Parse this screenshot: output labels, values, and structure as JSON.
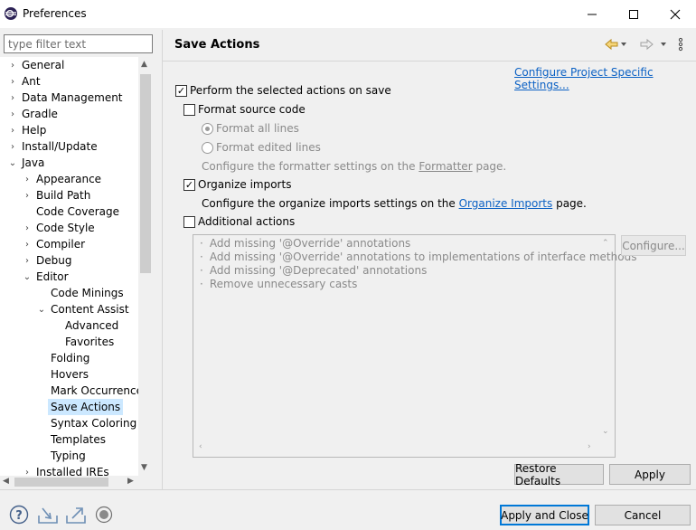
{
  "window": {
    "title": "Preferences",
    "minimize": "—",
    "maximize": "☐",
    "close": "✕"
  },
  "filter": {
    "placeholder": "type filter text"
  },
  "tree": [
    {
      "label": "General",
      "expander": "›"
    },
    {
      "label": "Ant",
      "expander": "›"
    },
    {
      "label": "Data Management",
      "expander": "›"
    },
    {
      "label": "Gradle",
      "expander": "›"
    },
    {
      "label": "Help",
      "expander": "›"
    },
    {
      "label": "Install/Update",
      "expander": "›"
    },
    {
      "label": "Java",
      "expander": "⌄"
    },
    {
      "label": "Appearance",
      "expander": "›"
    },
    {
      "label": "Build Path",
      "expander": "›"
    },
    {
      "label": "Code Coverage",
      "expander": ""
    },
    {
      "label": "Code Style",
      "expander": "›"
    },
    {
      "label": "Compiler",
      "expander": "›"
    },
    {
      "label": "Debug",
      "expander": "›"
    },
    {
      "label": "Editor",
      "expander": "⌄"
    },
    {
      "label": "Code Minings",
      "expander": ""
    },
    {
      "label": "Content Assist",
      "expander": "⌄"
    },
    {
      "label": "Advanced",
      "expander": ""
    },
    {
      "label": "Favorites",
      "expander": ""
    },
    {
      "label": "Folding",
      "expander": ""
    },
    {
      "label": "Hovers",
      "expander": ""
    },
    {
      "label": "Mark Occurrences",
      "expander": ""
    },
    {
      "label": "Save Actions",
      "expander": ""
    },
    {
      "label": "Syntax Coloring",
      "expander": ""
    },
    {
      "label": "Templates",
      "expander": ""
    },
    {
      "label": "Typing",
      "expander": ""
    },
    {
      "label": "Installed JREs",
      "expander": "›"
    }
  ],
  "page": {
    "title": "Save Actions",
    "config_link": "Configure Project Specific Settings...",
    "perform": {
      "label": "Perform the selected actions on save",
      "checked": true
    },
    "format_source": {
      "label": "Format source code",
      "checked": false
    },
    "format_all": "Format all lines",
    "format_edited": "Format edited lines",
    "formatter_pre": "Configure the formatter settings on the",
    "formatter_link": "Formatter",
    "formatter_post": "page.",
    "organize": {
      "label": "Organize imports",
      "checked": true
    },
    "organize_pre": "Configure the organize imports settings on the",
    "organize_link": "Organize Imports",
    "organize_post": "page.",
    "additional": {
      "label": "Additional actions",
      "checked": false
    },
    "actions": [
      "Add missing '@Override' annotations",
      "Add missing '@Override' annotations to implementations of interface methods",
      "Add missing '@Deprecated' annotations",
      "Remove unnecessary casts"
    ],
    "configure_button": "Configure...",
    "restore_defaults": "Restore Defaults",
    "apply": "Apply"
  },
  "footer": {
    "apply_close": "Apply and Close",
    "cancel": "Cancel"
  },
  "glyphs": {
    "bullet": "·",
    "check": "✓"
  }
}
